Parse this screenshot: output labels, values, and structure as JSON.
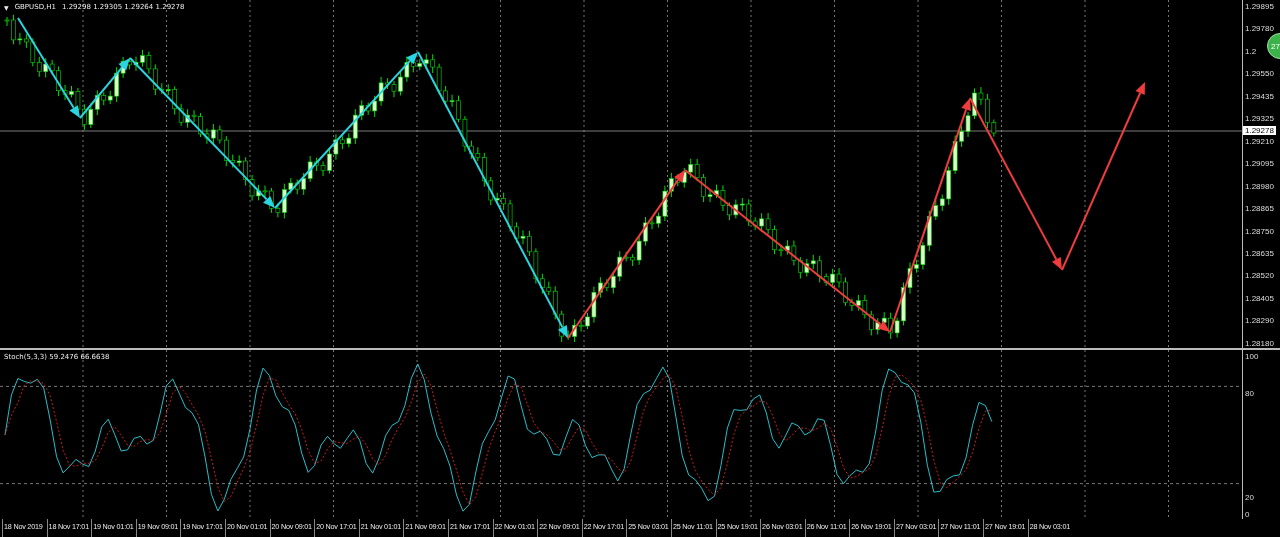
{
  "chart": {
    "menu_glyph": "▼",
    "symbol": "GBPUSD,H1",
    "ohlc": "1.29298 1.29305 1.29264 1.29278",
    "current_price": "1.29278",
    "badge": "27"
  },
  "price_axis": {
    "labels": [
      "1.29895",
      "1.29780",
      "1.2",
      "1.29550",
      "1.29435",
      "1.29325",
      "1.29210",
      "1.29095",
      "1.28980",
      "1.28865",
      "1.28750",
      "1.28635",
      "1.28520",
      "1.28405",
      "1.28290",
      "1.28180"
    ]
  },
  "indicator": {
    "title": "Stoch(5,3,3) 59.2476 66.6638",
    "levels": [
      "100",
      "80",
      "20",
      "0"
    ]
  },
  "time_axis": {
    "labels": [
      "18 Nov 2019",
      "18 Nov 17:01",
      "19 Nov 01:01",
      "19 Nov 09:01",
      "19 Nov 17:01",
      "20 Nov 01:01",
      "20 Nov 09:01",
      "20 Nov 17:01",
      "21 Nov 01:01",
      "21 Nov 09:01",
      "21 Nov 17:01",
      "22 Nov 01:01",
      "22 Nov 09:01",
      "22 Nov 17:01",
      "25 Nov 03:01",
      "25 Nov 11:01",
      "25 Nov 19:01",
      "26 Nov 03:01",
      "26 Nov 11:01",
      "26 Nov 19:01",
      "27 Nov 03:01",
      "27 Nov 11:01",
      "27 Nov 19:01",
      "28 Nov 03:01"
    ]
  }
}
